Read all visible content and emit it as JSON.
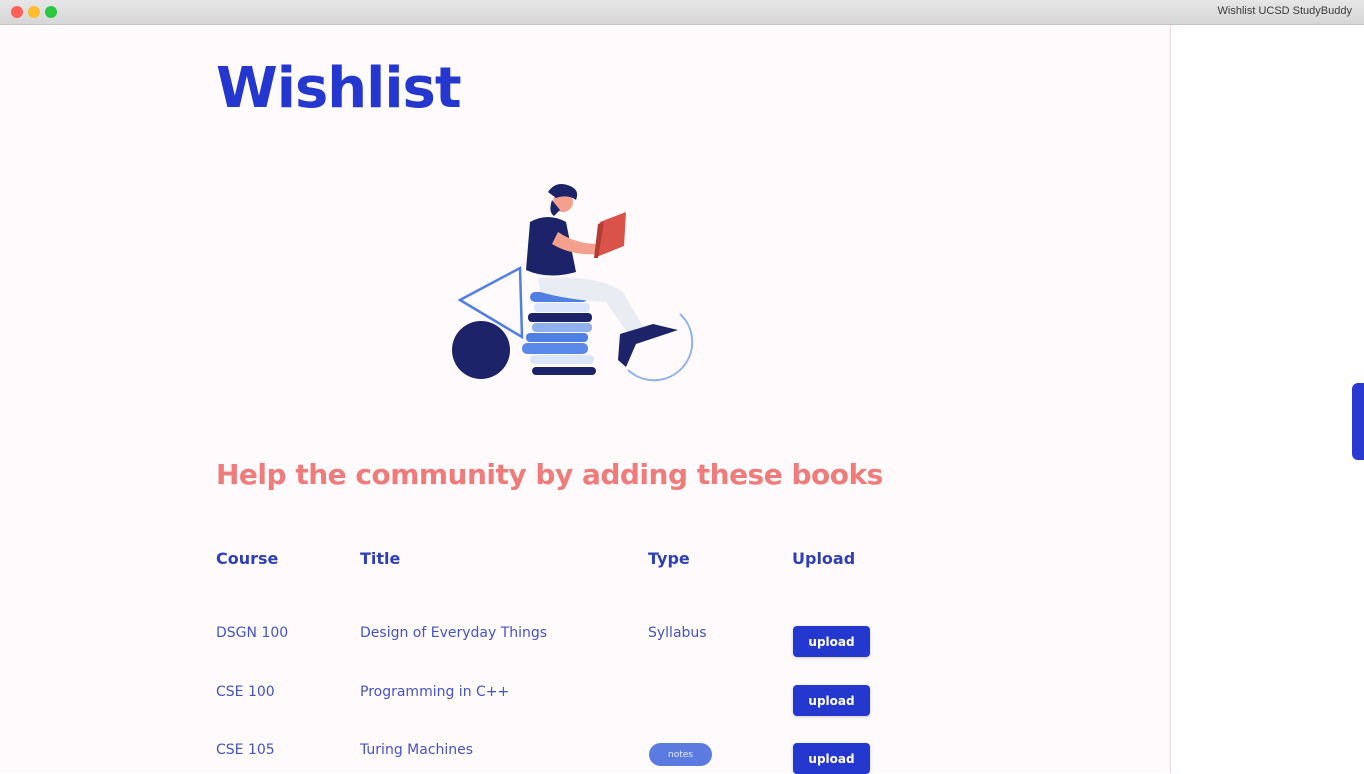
{
  "window": {
    "title": "Wishlist UCSD StudyBuddy"
  },
  "page": {
    "title": "Wishlist",
    "subtitle": "Help the community by adding these books"
  },
  "table": {
    "headers": [
      "Course",
      "Title",
      "Type",
      "Upload"
    ],
    "rows": [
      {
        "course": "DSGN 100",
        "title": "Design of Everyday Things",
        "type": "Syllabus",
        "upload_label": "upload"
      },
      {
        "course": "CSE 100",
        "title": "Programming in C++",
        "type": "",
        "upload_label": "upload"
      },
      {
        "course": "CSE 105",
        "title": "Turing Machines",
        "type_badge": "notes",
        "upload_label": "upload"
      }
    ]
  },
  "colors": {
    "primary": "#2437cf",
    "accent": "#ef7b7b",
    "background": "#fffafb"
  },
  "illustration": {
    "icon": "person-reading-on-books-illustration"
  }
}
